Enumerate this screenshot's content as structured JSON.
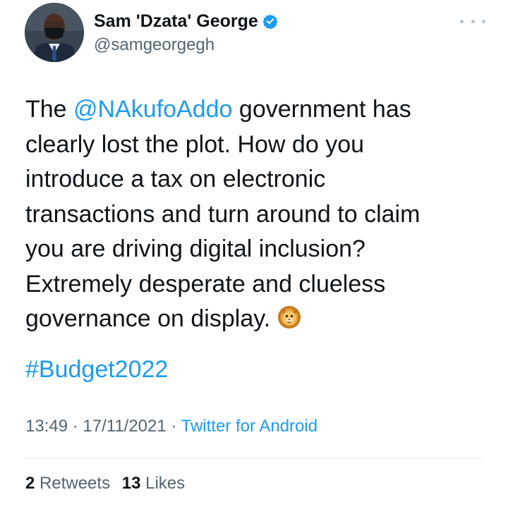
{
  "author": {
    "display_name": "Sam 'Dzata' George",
    "handle": "@samgeorgegh",
    "verified_icon": "verified-badge-icon",
    "avatar": "profile-photo"
  },
  "menu": {
    "icon": "more-options-icon"
  },
  "tweet": {
    "lines": [
      {
        "pre": "The ",
        "mention": "@NAkufoAddo",
        "post": " government has"
      },
      {
        "text": "clearly lost the plot. How do you"
      },
      {
        "text": "introduce a tax on electronic"
      },
      {
        "text": "transactions and turn around to claim"
      },
      {
        "text": "you are driving digital inclusion?"
      },
      {
        "text": "Extremely desperate and clueless"
      },
      {
        "text": "governance on display."
      }
    ],
    "emoji": "lion-face-emoji",
    "hashtag": "#Budget2022"
  },
  "meta": {
    "time": "13:49",
    "sep1": " · ",
    "date": "17/11/2021",
    "sep2": " · ",
    "source": "Twitter for Android"
  },
  "stats": {
    "retweets_count": "2",
    "retweets_label": "Retweets",
    "likes_count": "13",
    "likes_label": "Likes"
  },
  "colors": {
    "link": "#1d9bf0",
    "text": "#0f1419",
    "secondary": "#536471",
    "verified": "#1d9bf0"
  }
}
